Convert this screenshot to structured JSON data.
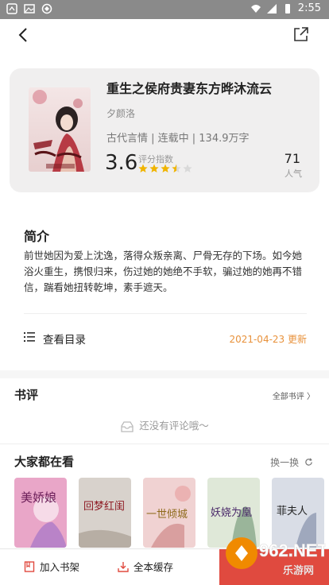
{
  "status_bar": {
    "time": "2:55"
  },
  "book": {
    "title": "重生之侯府贵妻东方晔沐流云",
    "author": "夕颜洛",
    "meta": "古代言情 | 连载中 | 134.9万字",
    "score": "3.6",
    "score_label": "评分指数",
    "rating_stars": 3.5,
    "popularity": "71",
    "popularity_label": "人气"
  },
  "intro": {
    "heading": "简介",
    "text": "前世她因为爱上沈逸，落得众叛亲离、尸骨无存的下场。如今她浴火重生，携恨归来，伤过她的她绝不手软，骗过她的她再不错信，踹看她扭转乾坤，素手遮天。"
  },
  "catalog": {
    "label": "查看目录",
    "update": "2021-04-23 更新"
  },
  "reviews": {
    "heading": "书评",
    "all_label": "全部书评 〉",
    "empty_text": "还没有评论哦～"
  },
  "recommend": {
    "heading": "大家都在看",
    "swap_label": "换一换",
    "items": [
      {
        "cover_text": "美娇娘",
        "color": "#e9a6c8"
      },
      {
        "cover_text": "回梦红闺",
        "color": "#d8d2cc"
      },
      {
        "cover_text": "一世倾城",
        "color": "#f0d2d2"
      },
      {
        "cover_text": "妖娆为凰",
        "color": "#dfe8d8"
      },
      {
        "cover_text": "菲夫人",
        "color": "#d9dde6"
      }
    ]
  },
  "bottom_bar": {
    "add_shelf": "加入书架",
    "cache_all": "全本缓存",
    "read_label": ""
  },
  "colors": {
    "accent": "#e04a3f",
    "date": "#e8923c",
    "star": "#f0b400",
    "card_bg": "#f0efef"
  },
  "watermark": {
    "text": "962.NET",
    "subtext": "乐游网"
  }
}
